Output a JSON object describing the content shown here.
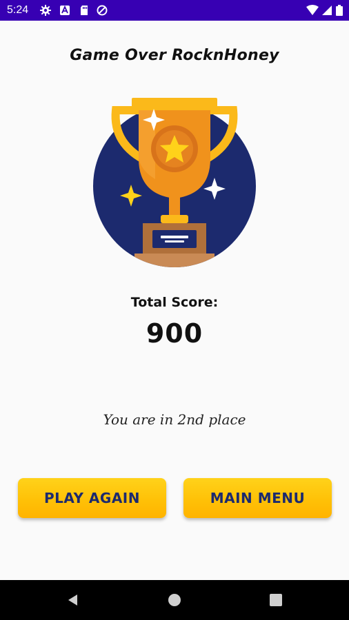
{
  "status_bar": {
    "time": "5:24",
    "background": "#3700b3",
    "left_icons": [
      "gear-icon",
      "keyboard-app-icon",
      "sd-card-icon",
      "data-saver-icon"
    ],
    "right_icons": [
      "wifi-icon",
      "signal-icon",
      "battery-icon"
    ]
  },
  "game_over": {
    "title": "Game Over RocknHoney",
    "score_label": "Total Score:",
    "score_value": "900",
    "place_text": "You are in 2nd place"
  },
  "buttons": {
    "play_again": "PLAY AGAIN",
    "main_menu": "MAIN MENU",
    "color": "#ffc107",
    "text_color": "#1c2a6e"
  },
  "trophy": {
    "circle_color": "#1c2a6e",
    "cup_color": "#f0921c",
    "star_color": "#ffd21a"
  },
  "nav_bar": {
    "icons": [
      "back-icon",
      "home-icon",
      "recents-icon"
    ]
  }
}
